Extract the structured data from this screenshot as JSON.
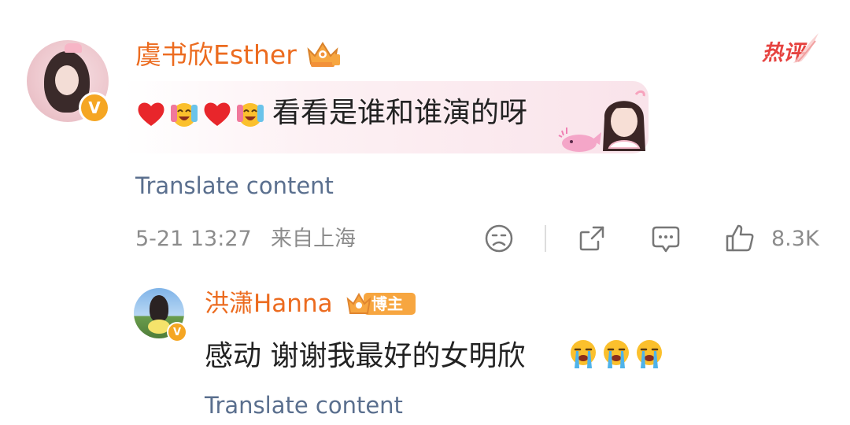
{
  "comment": {
    "author": {
      "name": "虞书欣Esther",
      "verified_mark": "V",
      "badge_icon": "vip-crown-icon"
    },
    "hot_tag": "热评",
    "emoji_prefix": [
      "red-heart-icon",
      "crying-laughing-icon",
      "red-heart-icon",
      "crying-laughing-icon"
    ],
    "text": "看看是谁和谁演的呀",
    "translate_label": "Translate content",
    "time": "5-21 13:27",
    "location": "来自上海",
    "actions": {
      "dislike_icon": "sad-face-icon",
      "share_icon": "share-icon",
      "comment_icon": "comment-icon",
      "like_icon": "thumbs-up-icon",
      "like_count": "8.3K"
    }
  },
  "reply": {
    "author": {
      "name": "洪潇Hanna",
      "verified_mark": "V",
      "badge_label": "博主"
    },
    "text": "感动 谢谢我最好的女明欣",
    "emoji_suffix": [
      "crying-face-icon",
      "crying-face-icon",
      "crying-face-icon"
    ],
    "translate_label": "Translate content"
  },
  "colors": {
    "username": "#ec6b1f",
    "hot_tag": "#e64340",
    "translate_link": "#5a6f8e",
    "meta_text": "#8c8c8c",
    "verified_badge": "#f5a623"
  }
}
